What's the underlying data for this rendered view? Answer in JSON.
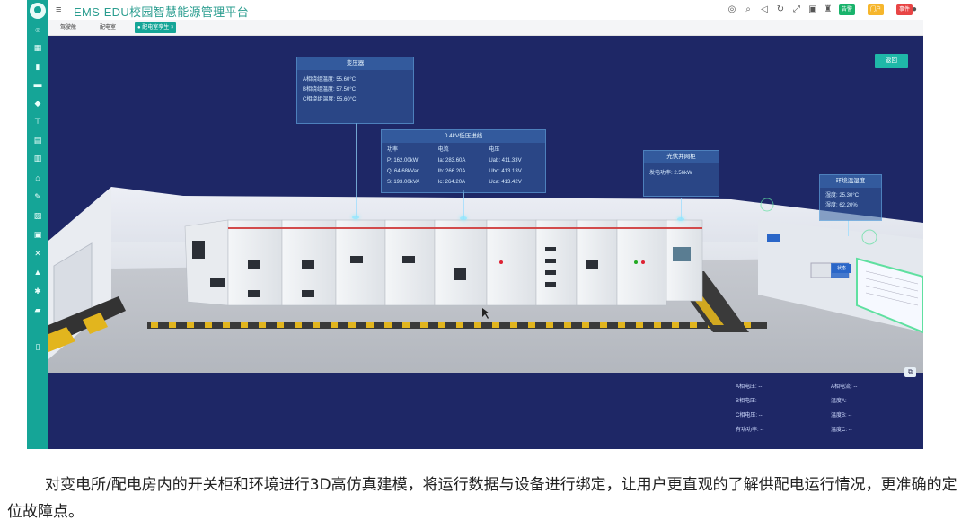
{
  "app": {
    "title": "EMS-EDU校园智慧能源管理平台"
  },
  "header": {
    "badges": [
      {
        "label": "告警",
        "color": "#19b36b"
      },
      {
        "label": "门户",
        "color": "#f6b62c"
      },
      {
        "label": "事件",
        "color": "#e84545"
      }
    ]
  },
  "tabs": [
    {
      "label": "驾驶舱"
    },
    {
      "label": "配电室"
    },
    {
      "label": "● 配电室孪生 ×"
    }
  ],
  "scene": {
    "return_label": "返回",
    "transformer": {
      "title": "变压器",
      "rows": [
        "A相绕组温度: 55.60°C",
        "B相绕组温度: 57.50°C",
        "C相绕组温度: 55.60°C"
      ]
    },
    "lv_incoming": {
      "title": "0.4kV低压进线",
      "headers": [
        "功率",
        "电流",
        "电压"
      ],
      "rows": [
        [
          "P: 162.00kW",
          "Ia: 283.60A",
          "Uab: 411.33V"
        ],
        [
          "Q: 64.68kVar",
          "Ib: 266.20A",
          "Ubc: 413.13V"
        ],
        [
          "S: 193.00kVA",
          "Ic: 264.20A",
          "Uca: 413.42V"
        ]
      ]
    },
    "pv": {
      "title": "光伏并网柜",
      "rows": [
        "发电功率: 2.56kW"
      ]
    },
    "env": {
      "title": "环境温湿度",
      "rows": [
        "湿度: 25.30°C",
        "湿度: 62.20%"
      ]
    },
    "equipment_label": "状态",
    "bottom_info": {
      "left": [
        "A相电压: --",
        "B相电压: --",
        "C相电压: --",
        "有功功率: --"
      ],
      "right": [
        "A相电流: --",
        "温度A: --",
        "温度B: --",
        "温度C: --"
      ]
    }
  },
  "caption": "对变电所/配电房内的开关柜和环境进行3D高仿真建模，将运行数据与设备进行绑定，让用户更直观的了解供配电运行情况，更准确的定位故障点。"
}
